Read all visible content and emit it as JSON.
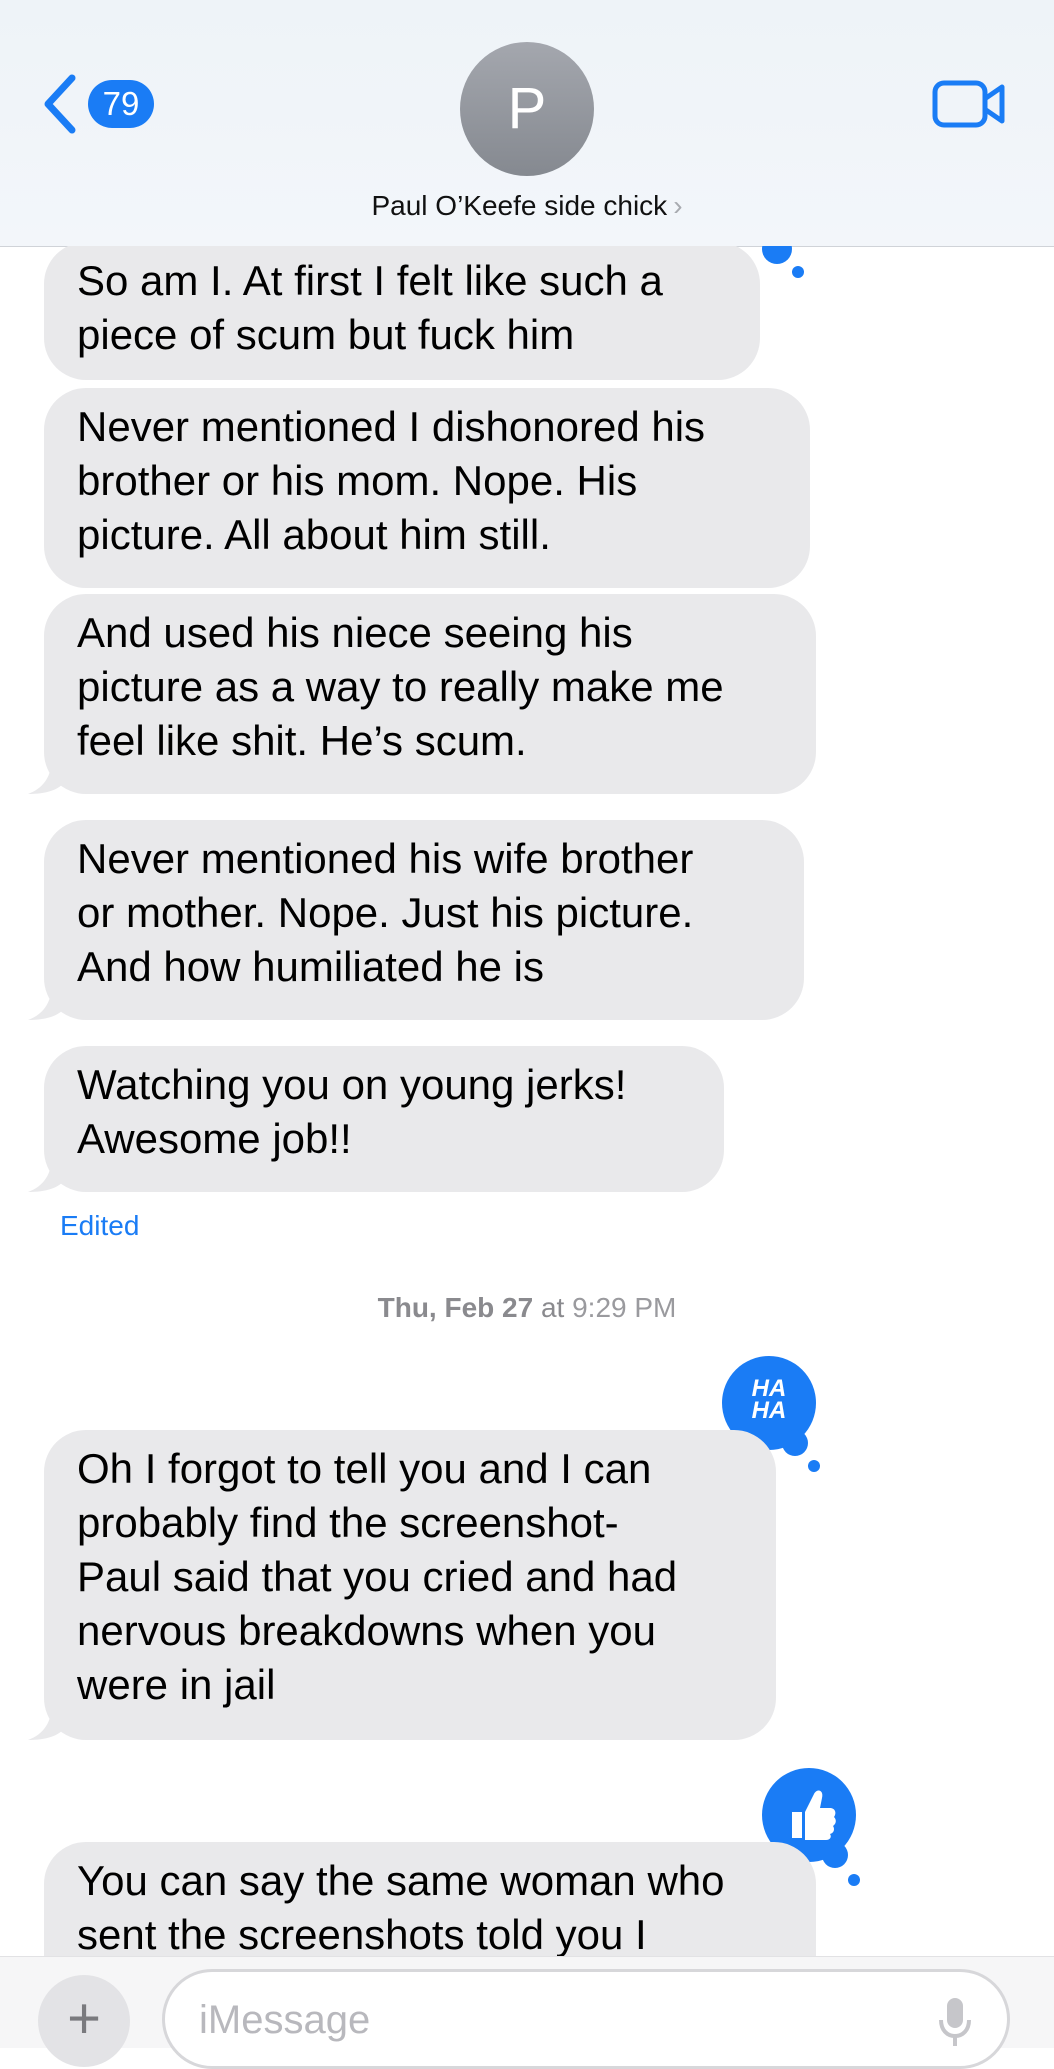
{
  "header": {
    "back_count": "79",
    "avatar_initial": "P",
    "contact_name": "Paul O’Keefe side chick",
    "contact_chevron": "›"
  },
  "messages": [
    {
      "text": "So am I. At first I felt like such a\npiece of scum but fuck him"
    },
    {
      "text": "Never mentioned I dishonored his\nbrother or his mom. Nope. His\npicture. All about him still."
    },
    {
      "text": "And used his niece seeing his\npicture as a way to really make me\nfeel like shit. He’s scum."
    },
    {
      "text": "Never mentioned his wife brother\nor mother. Nope. Just his picture.\nAnd how humiliated he is"
    },
    {
      "text": "Watching you on young jerks!\nAwesome job!!"
    },
    {
      "text": "Oh I forgot to tell you and I can\nprobably find the screenshot-\nPaul said that you cried and had\nnervous breakdowns when you\nwere in jail"
    },
    {
      "text": "You can say the same woman who\nsent the screenshots told you I"
    }
  ],
  "edited_label": "Edited",
  "timestamp": {
    "day": "Thu, Feb 27",
    "at": "at",
    "time": "9:29 PM"
  },
  "reactions": {
    "haha_line1": "HA",
    "haha_line2": "HA",
    "haha_icon": "haha-reaction",
    "like_icon": "thumbs-up-reaction"
  },
  "input": {
    "placeholder": "iMessage",
    "plus": "+"
  },
  "colors": {
    "accent": "#1a7cf5",
    "received_bubble": "#e9e9eb"
  }
}
